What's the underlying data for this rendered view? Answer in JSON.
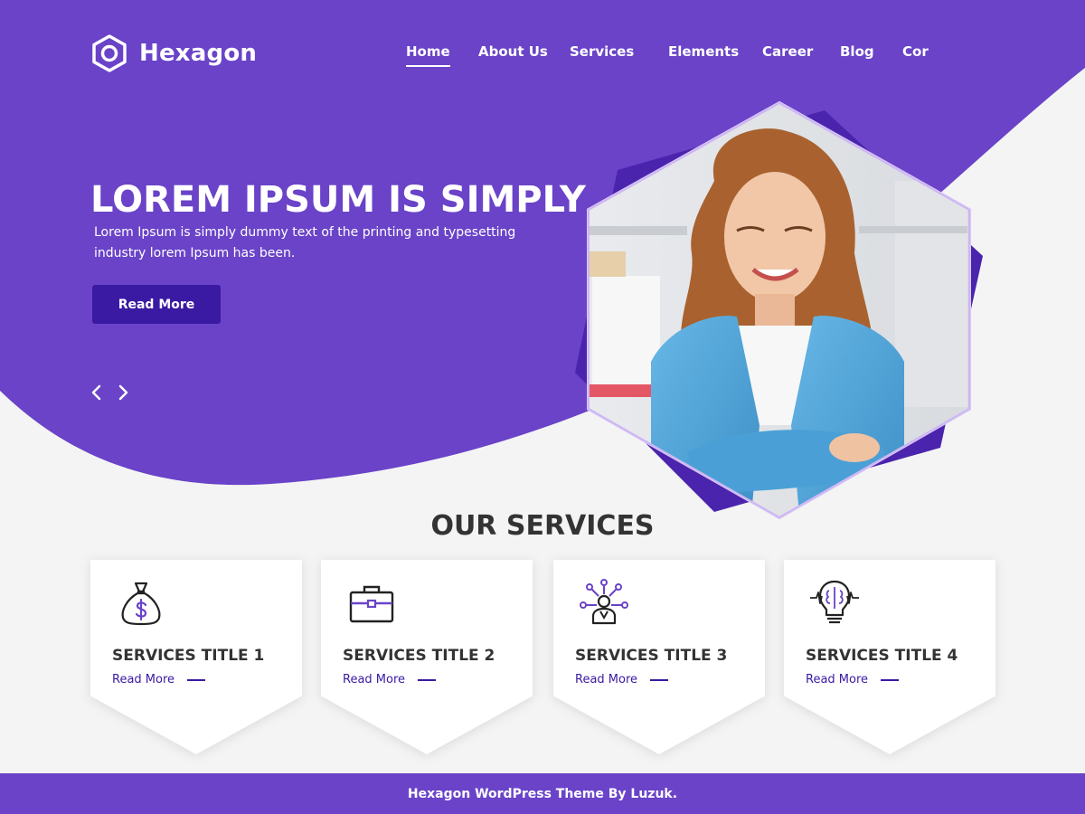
{
  "colors": {
    "primary_purple": "#6a43c8",
    "dark_purple": "#3a1aa3",
    "page_bg": "#f4f4f4",
    "text_dark": "#333333",
    "white": "#ffffff"
  },
  "header": {
    "logo_text": "Hexagon",
    "logo_icon": "hexagon-logo-icon",
    "nav": [
      {
        "label": "Home",
        "active": true
      },
      {
        "label": "About Us",
        "active": false
      },
      {
        "label": "Services",
        "active": false
      },
      {
        "label": "Elements",
        "active": false
      },
      {
        "label": "Career",
        "active": false
      },
      {
        "label": "Blog",
        "active": false
      },
      {
        "label": "Cor",
        "active": false
      }
    ]
  },
  "hero": {
    "title": "LOREM IPSUM IS SIMPLY",
    "text": "Lorem Ipsum is simply dummy text of the printing and typesetting industry  lorem Ipsum has been.",
    "button_label": "Read More",
    "prev_icon": "chevron-left-icon",
    "next_icon": "chevron-right-icon",
    "image_subject": "hero-portrait-image"
  },
  "services": {
    "title": "OUR SERVICES",
    "items": [
      {
        "title": "SERVICES TITLE 1",
        "link": "Read More",
        "icon": "money-bag-icon"
      },
      {
        "title": "SERVICES TITLE 2",
        "link": "Read More",
        "icon": "briefcase-icon"
      },
      {
        "title": "SERVICES TITLE 3",
        "link": "Read More",
        "icon": "network-person-icon"
      },
      {
        "title": "SERVICES TITLE 4",
        "link": "Read More",
        "icon": "lightbulb-brain-icon"
      }
    ]
  },
  "footer": {
    "text": "Hexagon WordPress Theme By Luzuk."
  }
}
